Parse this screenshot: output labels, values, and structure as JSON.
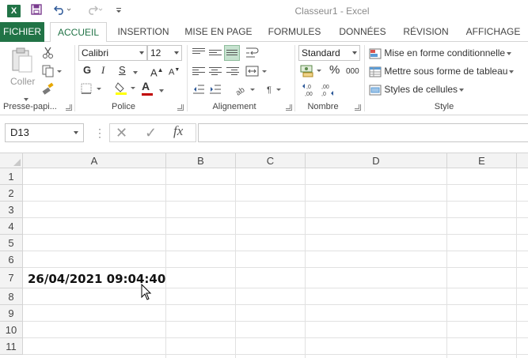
{
  "app": {
    "title": "Classeur1 - Excel",
    "logo_letter": "X",
    "accent_color": "#217346",
    "quick_access": [
      "save-icon",
      "undo-icon",
      "redo-icon",
      "customize-icon"
    ]
  },
  "tabs": [
    {
      "label": "FICHIER"
    },
    {
      "label": "ACCUEIL",
      "active": true
    },
    {
      "label": "INSERTION"
    },
    {
      "label": "MISE EN PAGE"
    },
    {
      "label": "FORMULES"
    },
    {
      "label": "DONNÉES"
    },
    {
      "label": "RÉVISION"
    },
    {
      "label": "AFFICHAGE"
    }
  ],
  "ribbon": {
    "clipboard": {
      "paste_label": "Coller",
      "group_label": "Presse-papi..."
    },
    "font": {
      "name": "Calibri",
      "size": "12",
      "bold": "G",
      "italic": "I",
      "underline": "S",
      "grow": "A",
      "shrink": "A",
      "color_letter": "A",
      "group_label": "Police",
      "fill_color": "#ffff00",
      "font_color": "#c00000"
    },
    "alignment": {
      "group_label": "Alignement"
    },
    "number": {
      "format": "Standard",
      "percent": "%",
      "thousands": "000",
      "inc_decimal": ",0\n,00",
      "dec_decimal": ",00\n,0",
      "group_label": "Nombre"
    },
    "style": {
      "conditional": "Mise en forme conditionnelle",
      "table": "Mettre sous forme de tableau",
      "cell_styles": "Styles de cellules",
      "group_label": "Style"
    }
  },
  "formula_bar": {
    "name_box": "D13",
    "cancel": "✕",
    "enter": "✓",
    "fx": "fx",
    "value": ""
  },
  "sheet": {
    "columns": [
      "A",
      "B",
      "C",
      "D",
      "E"
    ],
    "rows": [
      "1",
      "2",
      "3",
      "4",
      "5",
      "6",
      "7",
      "8",
      "9",
      "10",
      "11"
    ],
    "cells": {
      "A7": "26/04/2021 09:04:40"
    }
  }
}
